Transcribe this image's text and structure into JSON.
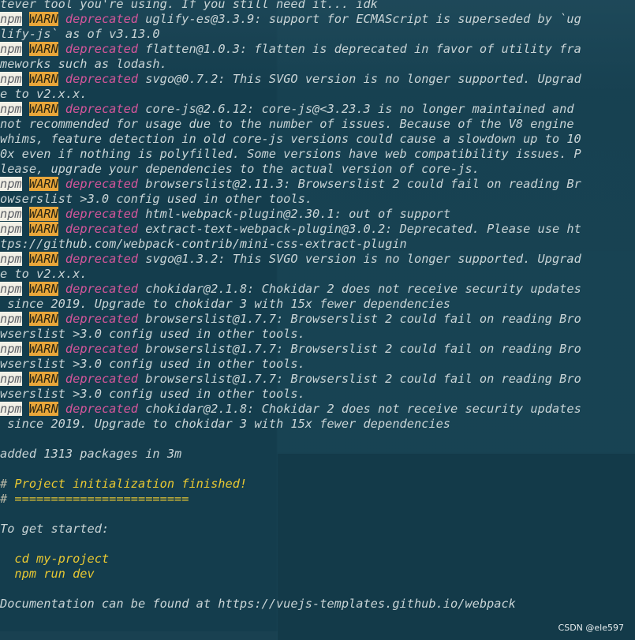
{
  "terminal": {
    "lines": [
      {
        "type": "text",
        "text": "tever tool you're using. If you still need it... idk"
      },
      {
        "type": "warn",
        "npm": "npm",
        "warn": "WARN",
        "dep": "deprecated",
        "msg": " uglify-es@3.3.9: support for ECMAScript is superseded by `ug"
      },
      {
        "type": "text",
        "text": "lify-js` as of v3.13.0"
      },
      {
        "type": "warn",
        "npm": "npm",
        "warn": "WARN",
        "dep": "deprecated",
        "msg": " flatten@1.0.3: flatten is deprecated in favor of utility fra"
      },
      {
        "type": "text",
        "text": "meworks such as lodash."
      },
      {
        "type": "warn",
        "npm": "npm",
        "warn": "WARN",
        "dep": "deprecated",
        "msg": " svgo@0.7.2: This SVGO version is no longer supported. Upgrad"
      },
      {
        "type": "text",
        "text": "e to v2.x.x."
      },
      {
        "type": "warn",
        "npm": "npm",
        "warn": "WARN",
        "dep": "deprecated",
        "msg": " core-js@2.6.12: core-js@<3.23.3 is no longer maintained and"
      },
      {
        "type": "text",
        "text": "not recommended for usage due to the number of issues. Because of the V8 engine"
      },
      {
        "type": "text",
        "text": "whims, feature detection in old core-js versions could cause a slowdown up to 10"
      },
      {
        "type": "text",
        "text": "0x even if nothing is polyfilled. Some versions have web compatibility issues. P"
      },
      {
        "type": "text",
        "text": "lease, upgrade your dependencies to the actual version of core-js."
      },
      {
        "type": "warn",
        "npm": "npm",
        "warn": "WARN",
        "dep": "deprecated",
        "msg": " browserslist@2.11.3: Browserslist 2 could fail on reading Br"
      },
      {
        "type": "text",
        "text": "owserslist >3.0 config used in other tools."
      },
      {
        "type": "warn",
        "npm": "npm",
        "warn": "WARN",
        "dep": "deprecated",
        "msg": " html-webpack-plugin@2.30.1: out of support"
      },
      {
        "type": "warn",
        "npm": "npm",
        "warn": "WARN",
        "dep": "deprecated",
        "msg": " extract-text-webpack-plugin@3.0.2: Deprecated. Please use ht"
      },
      {
        "type": "text",
        "text": "tps://github.com/webpack-contrib/mini-css-extract-plugin"
      },
      {
        "type": "warn",
        "npm": "npm",
        "warn": "WARN",
        "dep": "deprecated",
        "msg": " svgo@1.3.2: This SVGO version is no longer supported. Upgrad"
      },
      {
        "type": "text",
        "text": "e to v2.x.x."
      },
      {
        "type": "warn",
        "npm": "npm",
        "warn": "WARN",
        "dep": "deprecated",
        "msg": " chokidar@2.1.8: Chokidar 2 does not receive security updates"
      },
      {
        "type": "text",
        "text": " since 2019. Upgrade to chokidar 3 with 15x fewer dependencies"
      },
      {
        "type": "warn",
        "npm": "npm",
        "warn": "WARN",
        "dep": "deprecated",
        "msg": " browserslist@1.7.7: Browserslist 2 could fail on reading Bro"
      },
      {
        "type": "text",
        "text": "wserslist >3.0 config used in other tools."
      },
      {
        "type": "warn",
        "npm": "npm",
        "warn": "WARN",
        "dep": "deprecated",
        "msg": " browserslist@1.7.7: Browserslist 2 could fail on reading Bro"
      },
      {
        "type": "text",
        "text": "wserslist >3.0 config used in other tools."
      },
      {
        "type": "warn",
        "npm": "npm",
        "warn": "WARN",
        "dep": "deprecated",
        "msg": " browserslist@1.7.7: Browserslist 2 could fail on reading Bro"
      },
      {
        "type": "text",
        "text": "wserslist >3.0 config used in other tools."
      },
      {
        "type": "warn",
        "npm": "npm",
        "warn": "WARN",
        "dep": "deprecated",
        "msg": " chokidar@2.1.8: Chokidar 2 does not receive security updates"
      },
      {
        "type": "text",
        "text": " since 2019. Upgrade to chokidar 3 with 15x fewer dependencies"
      },
      {
        "type": "text",
        "text": ""
      },
      {
        "type": "text",
        "text": "added 1313 packages in 3m"
      },
      {
        "type": "text",
        "text": ""
      },
      {
        "type": "comment",
        "prefix": "# ",
        "text": "Project initialization finished!"
      },
      {
        "type": "comment",
        "prefix": "# ",
        "text": "========================"
      },
      {
        "type": "text",
        "text": ""
      },
      {
        "type": "text",
        "text": "To get started:"
      },
      {
        "type": "text",
        "text": ""
      },
      {
        "type": "yellow",
        "text": "  cd my-project"
      },
      {
        "type": "yellow",
        "text": "  npm run dev"
      },
      {
        "type": "text",
        "text": ""
      },
      {
        "type": "text",
        "text": "Documentation can be found at https://vuejs-templates.github.io/webpack"
      }
    ]
  },
  "watermark": "CSDN @ele597",
  "colors": {
    "background": "#143d4d",
    "npm_badge_bg": "#f2f0e6",
    "warn_badge_bg": "#e8a63a",
    "deprecated": "#d5569b",
    "highlight": "#e9c832",
    "text": "#c9d4d6"
  }
}
